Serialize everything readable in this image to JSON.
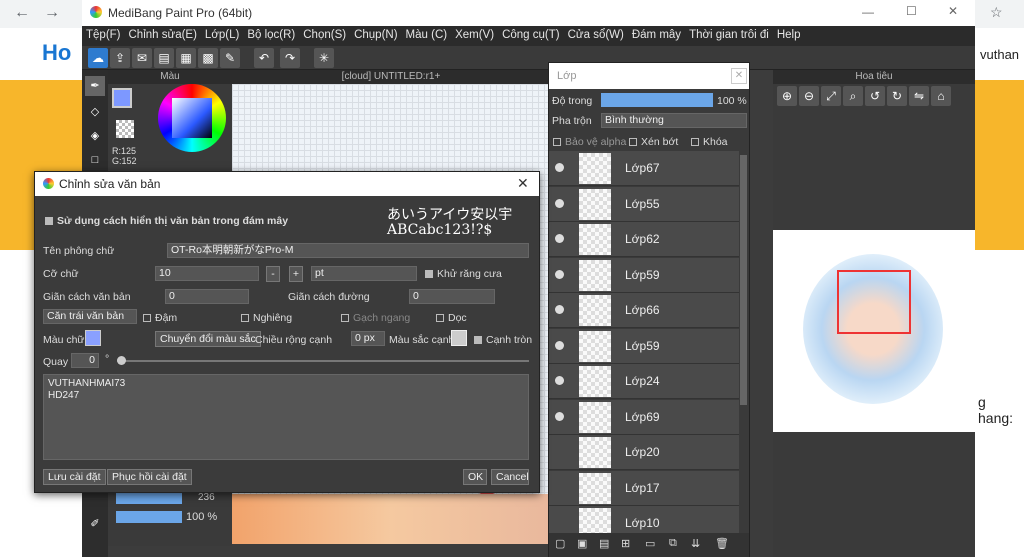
{
  "browser": {
    "back_glyph": "←",
    "forward_glyph": "→",
    "reload_glyph": "↻"
  },
  "web": {
    "logo": "Ho",
    "right_text": "vuthan",
    "side_text": "g hang:"
  },
  "app": {
    "title": "MediBang Paint Pro (64bit)",
    "menu": [
      "Tệp(F)",
      "Chỉnh sửa(E)",
      "Lớp(L)",
      "Bộ lọc(R)",
      "Chọn(S)",
      "Chụp(N)",
      "Màu (C)",
      "Xem(V)",
      "Công cụ(T)",
      "Cửa sổ(W)",
      "Đám mây",
      "Thời gian trôi đi",
      "Help"
    ],
    "window_controls": {
      "min": "—",
      "max": "☐",
      "close": "✕"
    }
  },
  "color_panel": {
    "title": "Màu",
    "r": "R:125",
    "g": "G:152"
  },
  "canvas": {
    "title": "[cloud] UNTITLED:r1+"
  },
  "brush_panel": {
    "value1": "236",
    "value2": "100 %"
  },
  "dialog": {
    "title": "Chỉnh sửa văn bản",
    "cloud_render_label": "Sử dụng cách hiển thị văn bản trong đám mây",
    "preview_line1": "あいうアイウ安以宇",
    "preview_line2": "ABCabc123!?$",
    "font_label": "Tên phông chữ",
    "font_value": "OT-Ro本明朝新がなPro-M",
    "size_label": "Cỡ chữ",
    "size_value": "10",
    "minus": "-",
    "plus": "+",
    "unit_value": "pt",
    "antialias_label": "Khử răng cưa",
    "letter_spacing_label": "Giãn cách văn bản",
    "letter_spacing_value": "0",
    "line_spacing_label": "Giãn cách đường",
    "line_spacing_value": "0",
    "align_value": "Căn trái văn bản",
    "bold_label": "Đậm",
    "italic_label": "Nghiêng",
    "strike_label": "Gạch ngang",
    "vertical_label": "Dọc",
    "color_label": "Màu chữ",
    "convert_color_button": "Chuyển đổi màu sắc",
    "edge_width_label": "Chiều rộng cạnh",
    "edge_width_value": "0 px",
    "edge_color_label": "Màu sắc cạnh",
    "round_edge_label": "Cạnh tròn",
    "rotate_label": "Quay",
    "rotate_value": "0",
    "degree": "°",
    "text_line1": "VUTHANHMAI73",
    "text_line2": "HD247",
    "save_button": "Lưu cài đặt",
    "restore_button": "Phục hồi cài đặt",
    "ok_button": "OK",
    "cancel_button": "Cancel",
    "close_glyph": "✕"
  },
  "layer_panel": {
    "title": "Lớp",
    "opacity_label": "Độ trong",
    "opacity_value": "100 %",
    "blend_label": "Pha trộn",
    "blend_value": "Bình thường",
    "protect_alpha": "Bảo vệ alpha",
    "clip": "Xén bớt",
    "lock": "Khóa",
    "layers": [
      "Lớp67",
      "Lớp55",
      "Lớp62",
      "Lớp59",
      "Lớp66",
      "Lớp59",
      "Lớp24",
      "Lớp69",
      "Lớp20",
      "Lớp17",
      "Lớp10"
    ]
  },
  "navigator": {
    "title": "Hoa tiêu"
  },
  "colors": {
    "accent": "#2e7bcf",
    "text_color_swatch": "#8aa0ff",
    "edge_color_swatch": "#cccccc"
  }
}
